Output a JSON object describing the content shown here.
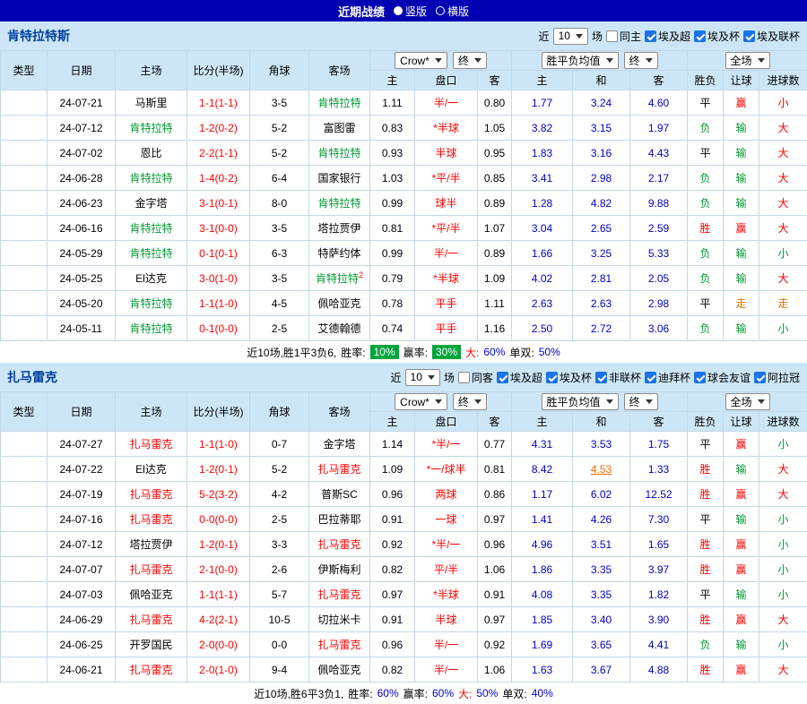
{
  "top_bar": {
    "title": "近期战绩",
    "vertical": "竖版",
    "horizontal": "横版"
  },
  "table_header": {
    "type": "类型",
    "date": "日期",
    "home": "主场",
    "score": "比分(半场)",
    "corner": "角球",
    "away": "客场",
    "bookmaker_select": "Crow*",
    "final_select": "终",
    "wdl_select": "胜平负均值",
    "final_select2": "终",
    "scope_select": "全场",
    "home_odds": "主",
    "handicap": "盘口",
    "away_odds": "客",
    "win": "主",
    "draw": "和",
    "lose": "客",
    "result": "胜负",
    "handicap_result": "让球",
    "goals": "进球数"
  },
  "sections": [
    {
      "team": "肯特拉特斯",
      "team_color": "green",
      "filter": {
        "near": "近",
        "count": "10",
        "games": "场",
        "same": {
          "label": "同主",
          "checked": false
        },
        "leagues": [
          {
            "label": "埃及超",
            "checked": true
          },
          {
            "label": "埃及杯",
            "checked": true
          },
          {
            "label": "埃及联杯",
            "checked": true
          }
        ]
      },
      "rows": [
        {
          "league": "埃及超",
          "league_cls": "lg-super",
          "date": "24-07-21",
          "home": "马斯里",
          "home_hl": false,
          "score": "1-1(1-1)",
          "corner": "3-5",
          "away": "肯特拉特",
          "away_hl": true,
          "o_home": "1.11",
          "handicap": "半/一",
          "o_away": "0.80",
          "eu_home": "1.77",
          "eu_draw": "3.24",
          "eu_away": "4.60",
          "result": "平",
          "result_cls": "black",
          "let": "赢",
          "let_cls": "red",
          "goal": "小",
          "goal_cls": "red"
        },
        {
          "league": "埃及超",
          "league_cls": "lg-super",
          "date": "24-07-12",
          "home": "肯特拉特",
          "home_hl": true,
          "score": "1-2(0-2)",
          "corner": "5-2",
          "away": "富图雷",
          "away_hl": false,
          "o_home": "0.83",
          "handicap": "*半球",
          "o_away": "1.05",
          "eu_home": "3.82",
          "eu_draw": "3.15",
          "eu_away": "1.97",
          "result": "负",
          "result_cls": "green",
          "let": "输",
          "let_cls": "green",
          "goal": "大",
          "goal_cls": "red"
        },
        {
          "league": "埃及超",
          "league_cls": "lg-super",
          "date": "24-07-02",
          "home": "恩比",
          "home_hl": false,
          "score": "2-2(1-1)",
          "corner": "5-2",
          "away": "肯特拉特",
          "away_hl": true,
          "o_home": "0.93",
          "handicap": "半球",
          "o_away": "0.95",
          "eu_home": "1.83",
          "eu_draw": "3.16",
          "eu_away": "4.43",
          "result": "平",
          "result_cls": "black",
          "let": "输",
          "let_cls": "green",
          "goal": "大",
          "goal_cls": "red"
        },
        {
          "league": "埃及超",
          "league_cls": "lg-super",
          "date": "24-06-28",
          "home": "肯特拉特",
          "home_hl": true,
          "score": "1-4(0-2)",
          "corner": "6-4",
          "away": "国家银行",
          "away_hl": false,
          "o_home": "1.03",
          "handicap": "*平/半",
          "o_away": "0.85",
          "eu_home": "3.41",
          "eu_draw": "2.98",
          "eu_away": "2.17",
          "result": "负",
          "result_cls": "green",
          "let": "输",
          "let_cls": "green",
          "goal": "大",
          "goal_cls": "red"
        },
        {
          "league": "埃及超",
          "league_cls": "lg-super",
          "date": "24-06-23",
          "home": "金字塔",
          "home_hl": false,
          "score": "3-1(0-1)",
          "corner": "8-0",
          "away": "肯特拉特",
          "away_hl": true,
          "o_home": "0.99",
          "handicap": "球半",
          "o_away": "0.89",
          "eu_home": "1.28",
          "eu_draw": "4.82",
          "eu_away": "9.88",
          "result": "负",
          "result_cls": "green",
          "let": "输",
          "let_cls": "green",
          "goal": "大",
          "goal_cls": "red"
        },
        {
          "league": "埃及超",
          "league_cls": "lg-super",
          "date": "24-06-16",
          "home": "肯特拉特",
          "home_hl": true,
          "score": "3-1(0-0)",
          "corner": "3-5",
          "away": "塔拉贾伊",
          "away_hl": false,
          "o_home": "0.81",
          "handicap": "*平/半",
          "o_away": "1.07",
          "eu_home": "3.04",
          "eu_draw": "2.65",
          "eu_away": "2.59",
          "result": "胜",
          "result_cls": "red",
          "let": "赢",
          "let_cls": "red",
          "goal": "大",
          "goal_cls": "red"
        },
        {
          "league": "埃及杯",
          "league_cls": "lg-cup",
          "date": "24-05-29",
          "home": "肯特拉特",
          "home_hl": true,
          "score": "0-1(0-1)",
          "corner": "6-3",
          "away": "特萨约体",
          "away_hl": false,
          "o_home": "0.99",
          "handicap": "半/一",
          "o_away": "0.89",
          "eu_home": "1.66",
          "eu_draw": "3.25",
          "eu_away": "5.33",
          "result": "负",
          "result_cls": "green",
          "let": "输",
          "let_cls": "green",
          "goal": "小",
          "goal_cls": "green"
        },
        {
          "league": "埃及超",
          "league_cls": "lg-super",
          "date": "24-05-25",
          "home": "El达克",
          "home_hl": false,
          "score": "3-0(1-0)",
          "corner": "3-5",
          "away": "肯特拉特",
          "away_hl": true,
          "away_sup": "2",
          "o_home": "0.79",
          "handicap": "*半球",
          "o_away": "1.09",
          "eu_home": "4.02",
          "eu_draw": "2.81",
          "eu_away": "2.05",
          "result": "负",
          "result_cls": "green",
          "let": "输",
          "let_cls": "green",
          "goal": "大",
          "goal_cls": "red"
        },
        {
          "league": "埃及超",
          "league_cls": "lg-super",
          "date": "24-05-20",
          "home": "肯特拉特",
          "home_hl": true,
          "score": "1-1(1-0)",
          "corner": "4-5",
          "away": "佩哈亚克",
          "away_hl": false,
          "o_home": "0.78",
          "handicap": "平手",
          "o_away": "1.11",
          "eu_home": "2.63",
          "eu_draw": "2.63",
          "eu_away": "2.98",
          "result": "平",
          "result_cls": "black",
          "let": "走",
          "let_cls": "orange",
          "goal": "走",
          "goal_cls": "orange"
        },
        {
          "league": "埃及超",
          "league_cls": "lg-super",
          "date": "24-05-11",
          "home": "肯特拉特",
          "home_hl": true,
          "score": "0-1(0-0)",
          "corner": "2-5",
          "away": "艾德翰德",
          "away_hl": false,
          "o_home": "0.74",
          "handicap": "平手",
          "o_away": "1.16",
          "eu_home": "2.50",
          "eu_draw": "2.72",
          "eu_away": "3.06",
          "result": "负",
          "result_cls": "green",
          "let": "输",
          "let_cls": "green",
          "goal": "小",
          "goal_cls": "green"
        }
      ],
      "footer": [
        {
          "text": "近10场,胜1平3负6,",
          "cls": "plain"
        },
        {
          "text": "胜率:",
          "cls": "plain"
        },
        {
          "text": "10%",
          "cls": "badge"
        },
        {
          "text": "赢率:",
          "cls": "plain"
        },
        {
          "text": "30%",
          "cls": "badge"
        },
        {
          "text": "大:",
          "cls": "red"
        },
        {
          "text": "60%",
          "cls": "blue"
        },
        {
          "text": "单双:",
          "cls": "plain"
        },
        {
          "text": "50%",
          "cls": "blue"
        }
      ]
    },
    {
      "team": "扎马雷克",
      "team_color": "red",
      "filter": {
        "near": "近",
        "count": "10",
        "games": "场",
        "same": {
          "label": "同客",
          "checked": false
        },
        "leagues": [
          {
            "label": "埃及超",
            "checked": true
          },
          {
            "label": "埃及杯",
            "checked": true
          },
          {
            "label": "非联杯",
            "checked": true
          },
          {
            "label": "迪拜杯",
            "checked": true
          },
          {
            "label": "球会友谊",
            "checked": true
          },
          {
            "label": "阿拉冠",
            "checked": true
          }
        ]
      },
      "rows": [
        {
          "league": "埃及超",
          "league_cls": "lg-super",
          "date": "24-07-27",
          "home": "扎马雷克",
          "home_hl": true,
          "score": "1-1(1-0)",
          "corner": "0-7",
          "away": "金字塔",
          "away_hl": false,
          "o_home": "1.14",
          "handicap": "*半/一",
          "o_away": "0.77",
          "eu_home": "4.31",
          "eu_draw": "3.53",
          "eu_away": "1.75",
          "result": "平",
          "result_cls": "black",
          "let": "赢",
          "let_cls": "red",
          "goal": "小",
          "goal_cls": "green"
        },
        {
          "league": "埃及超",
          "league_cls": "lg-super",
          "date": "24-07-22",
          "home": "El达克",
          "home_hl": false,
          "score": "1-2(0-1)",
          "corner": "5-2",
          "away": "扎马雷克",
          "away_hl": true,
          "o_home": "1.09",
          "handicap": "*一/球半",
          "o_away": "0.81",
          "eu_home": "8.42",
          "eu_draw": "4.53",
          "eu_draw_cls": "changed",
          "eu_away": "1.33",
          "result": "胜",
          "result_cls": "red",
          "let": "输",
          "let_cls": "green",
          "goal": "大",
          "goal_cls": "red"
        },
        {
          "league": "埃及杯",
          "league_cls": "lg-cup",
          "date": "24-07-19",
          "home": "扎马雷克",
          "home_hl": true,
          "score": "5-2(3-2)",
          "corner": "4-2",
          "away": "普斯SC",
          "away_hl": false,
          "o_home": "0.96",
          "handicap": "两球",
          "o_away": "0.86",
          "eu_home": "1.17",
          "eu_draw": "6.02",
          "eu_away": "12.52",
          "result": "胜",
          "result_cls": "red",
          "let": "赢",
          "let_cls": "red",
          "goal": "大",
          "goal_cls": "red"
        },
        {
          "league": "埃及超",
          "league_cls": "lg-super",
          "date": "24-07-16",
          "home": "扎马雷克",
          "home_hl": true,
          "score": "0-0(0-0)",
          "corner": "2-5",
          "away": "巴拉蒂耶",
          "away_hl": false,
          "o_home": "0.91",
          "handicap": "一球",
          "o_away": "0.97",
          "eu_home": "1.41",
          "eu_draw": "4.26",
          "eu_away": "7.30",
          "result": "平",
          "result_cls": "black",
          "let": "输",
          "let_cls": "green",
          "goal": "小",
          "goal_cls": "green"
        },
        {
          "league": "埃及超",
          "league_cls": "lg-super",
          "date": "24-07-12",
          "home": "塔拉贾伊",
          "home_hl": false,
          "score": "1-2(0-1)",
          "corner": "3-3",
          "away": "扎马雷克",
          "away_hl": true,
          "o_home": "0.92",
          "handicap": "*半/一",
          "o_away": "0.96",
          "eu_home": "4.96",
          "eu_draw": "3.51",
          "eu_away": "1.65",
          "result": "胜",
          "result_cls": "red",
          "let": "赢",
          "let_cls": "red",
          "goal": "小",
          "goal_cls": "green"
        },
        {
          "league": "埃及超",
          "league_cls": "lg-super",
          "date": "24-07-07",
          "home": "扎马雷克",
          "home_hl": true,
          "score": "2-1(0-0)",
          "corner": "2-6",
          "away": "伊斯梅利",
          "away_hl": false,
          "o_home": "0.82",
          "handicap": "平/半",
          "o_away": "1.06",
          "eu_home": "1.86",
          "eu_draw": "3.35",
          "eu_away": "3.97",
          "result": "胜",
          "result_cls": "red",
          "let": "赢",
          "let_cls": "red",
          "goal": "小",
          "goal_cls": "green"
        },
        {
          "league": "埃及超",
          "league_cls": "lg-super",
          "date": "24-07-03",
          "home": "佩哈亚克",
          "home_hl": false,
          "score": "1-1(1-1)",
          "corner": "5-7",
          "away": "扎马雷克",
          "away_hl": true,
          "o_home": "0.97",
          "handicap": "*半球",
          "o_away": "0.91",
          "eu_home": "4.08",
          "eu_draw": "3.35",
          "eu_away": "1.82",
          "result": "平",
          "result_cls": "black",
          "let": "输",
          "let_cls": "green",
          "goal": "小",
          "goal_cls": "green"
        },
        {
          "league": "埃及超",
          "league_cls": "lg-super",
          "date": "24-06-29",
          "home": "扎马雷克",
          "home_hl": true,
          "score": "4-2(2-1)",
          "corner": "10-5",
          "away": "切拉米卡",
          "away_hl": false,
          "o_home": "0.91",
          "handicap": "半球",
          "o_away": "0.97",
          "eu_home": "1.85",
          "eu_draw": "3.40",
          "eu_away": "3.90",
          "result": "胜",
          "result_cls": "red",
          "let": "赢",
          "let_cls": "red",
          "goal": "大",
          "goal_cls": "red"
        },
        {
          "league": "埃及超",
          "league_cls": "lg-super",
          "date": "24-06-25",
          "home": "开罗国民",
          "home_hl": false,
          "score": "2-0(0-0)",
          "corner": "0-0",
          "away": "扎马雷克",
          "away_hl": true,
          "o_home": "0.96",
          "handicap": "半/一",
          "o_away": "0.92",
          "eu_home": "1.69",
          "eu_draw": "3.65",
          "eu_away": "4.41",
          "result": "负",
          "result_cls": "green",
          "let": "输",
          "let_cls": "green",
          "goal": "小",
          "goal_cls": "green"
        },
        {
          "league": "埃及超",
          "league_cls": "lg-super",
          "date": "24-06-21",
          "home": "扎马雷克",
          "home_hl": true,
          "score": "2-0(1-0)",
          "corner": "9-4",
          "away": "佩哈亚克",
          "away_hl": false,
          "o_home": "0.82",
          "handicap": "半/一",
          "o_away": "1.06",
          "eu_home": "1.63",
          "eu_draw": "3.67",
          "eu_away": "4.88",
          "result": "胜",
          "result_cls": "red",
          "let": "赢",
          "let_cls": "red",
          "goal": "大",
          "goal_cls": "red"
        }
      ],
      "footer": [
        {
          "text": "近10场,胜6平3负1,",
          "cls": "plain"
        },
        {
          "text": "胜率:",
          "cls": "plain"
        },
        {
          "text": "60%",
          "cls": "blue"
        },
        {
          "text": "赢率:",
          "cls": "plain"
        },
        {
          "text": "60%",
          "cls": "blue"
        },
        {
          "text": "大:",
          "cls": "red"
        },
        {
          "text": "50%",
          "cls": "blue"
        },
        {
          "text": "单双:",
          "cls": "plain"
        },
        {
          "text": "40%",
          "cls": "blue"
        }
      ]
    }
  ]
}
